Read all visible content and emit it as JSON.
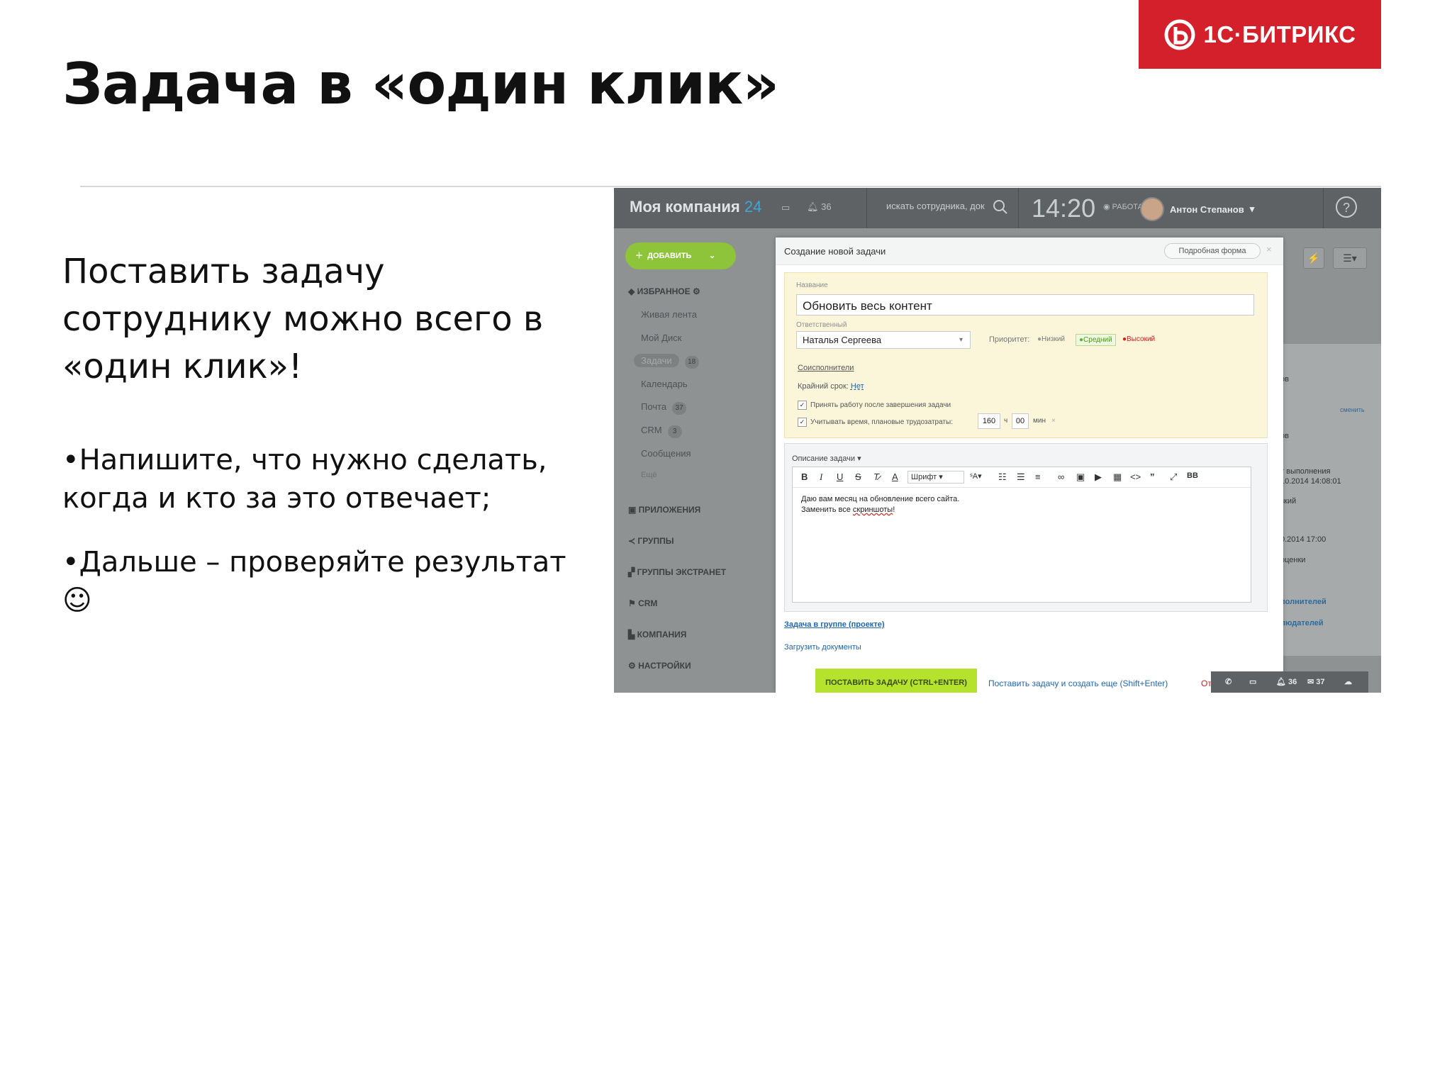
{
  "slide": {
    "title": "Задача в «один клик»",
    "lead": "Поставить задачу сотруднику можно всего в «один клик»!",
    "bullets": [
      "•Напишите, что нужно сделать, когда и кто за это отвечает;",
      "•Дальше – проверяйте результат ☺"
    ],
    "logo_text": "1С·БИТРИКС",
    "brand_color": "#d4202a"
  },
  "app": {
    "topbar": {
      "company": "Моя компания",
      "company_num": "24",
      "notifications": "36",
      "search_placeholder": "искать сотрудника, док",
      "time": "14:20",
      "status": "РАБОТАЮ",
      "user": "Антон Степанов",
      "help": "?"
    },
    "sidebar": {
      "add_label": "ДОБАВИТЬ",
      "favorites": "ИЗБРАННОЕ",
      "items": [
        {
          "label": "Живая лента",
          "badge": ""
        },
        {
          "label": "Мой Диск",
          "badge": ""
        },
        {
          "label": "Задачи",
          "badge": "18"
        },
        {
          "label": "Календарь",
          "badge": ""
        },
        {
          "label": "Почта",
          "badge": "37"
        },
        {
          "label": "CRM",
          "badge": "3"
        },
        {
          "label": "Сообщения",
          "badge": ""
        },
        {
          "label": "Ещё",
          "badge": ""
        }
      ],
      "sections": [
        "ПРИЛОЖЕНИЯ",
        "ГРУППЫ",
        "ГРУППЫ ЭКСТРАНЕТ",
        "CRM",
        "КОМПАНИЯ",
        "НАСТРОЙКИ"
      ]
    },
    "right_panel": {
      "lines": [
        "ов",
        "сменить",
        "ов",
        "т выполнения",
        "10.2014 14:08:01",
        "зкий",
        "0.2014 17:00",
        "оценки",
        "полнителей",
        "людателей"
      ]
    },
    "modal": {
      "title": "Создание новой задачи",
      "detail_button": "Подробная форма",
      "close": "×",
      "name_label": "Название",
      "name_value": "Обновить весь контент",
      "responsible_label": "Ответственный",
      "responsible_value": "Наталья Сергеева",
      "priority_label": "Приоритет:",
      "priority_low": "Низкий",
      "priority_mid": "Средний",
      "priority_high": "Высокий",
      "coexecutors": "Соисполнители",
      "deadline_label": "Крайний срок:",
      "deadline_value": "Нет",
      "accept_label": "Принять работу после завершения задачи",
      "time_label": "Учитывать время, плановые трудозатраты:",
      "hours": "160",
      "hours_unit": "ч",
      "minutes": "00",
      "minutes_unit": "мин",
      "desc_label": "Описание задачи",
      "font_select": "Шрифт",
      "desc_line1": "Даю вам месяц на обновление всего сайта.",
      "desc_line2_a": "Заменить все ",
      "desc_line2_b": "скриншоты",
      "desc_line2_c": "!",
      "group_link": "Задача в группе (проекте)",
      "upload_link": "Загрузить документы",
      "submit": "ПОСТАВИТЬ ЗАДАЧУ (CTRL+ENTER)",
      "submit_more": "Поставить задачу и создать еще (Shift+Enter)",
      "cancel": "Отм"
    },
    "bottom_bar": {
      "notifications": "36",
      "messages": "37"
    }
  }
}
